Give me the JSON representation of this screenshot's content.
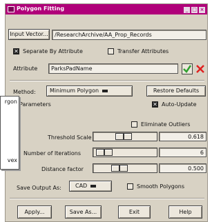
{
  "window": {
    "title": "Polygon Fitting",
    "title_buttons": [
      "_",
      "□",
      "×"
    ]
  },
  "input": {
    "button_label": "Input Vector...",
    "path": "/ResearchArchive/AA_Prop_Records"
  },
  "options": {
    "separate_by_attribute": {
      "label": "Separate By Attribute",
      "checked": true
    },
    "transfer_attributes": {
      "label": "Transfer Attributes",
      "checked": false
    }
  },
  "attribute": {
    "label": "Attribute",
    "value": "ParksPadName"
  },
  "method": {
    "label": "Method:",
    "value": "Minimum Polygon",
    "restore_label": "Restore Defaults"
  },
  "parameters": {
    "label": "Parameters",
    "auto_update": {
      "label": "Auto-Update",
      "checked": true
    },
    "eliminate_outliers": {
      "label": "Eliminate Outliers",
      "checked": false
    }
  },
  "sliders": [
    {
      "label": "Threshold Scale",
      "value": "0.618",
      "fraction": 0.47
    },
    {
      "label": "Number of Iterations",
      "value": "6",
      "fraction": 0.05
    },
    {
      "label": "Distance factor",
      "value": "0.500",
      "fraction": 0.38
    }
  ],
  "save_output": {
    "label": "Save Output As:",
    "value": "CAD",
    "smooth_label": "Smooth Polygons",
    "smooth_checked": false
  },
  "buttons": {
    "apply": "Apply...",
    "save_as": "Save As...",
    "exit": "Exit",
    "help": "Help"
  },
  "popup": {
    "items": [
      "rgon",
      "vex"
    ]
  },
  "colors": {
    "title_bar": "#b0007a",
    "panel": "#d8d2c4",
    "check_icon": "#2fa02f",
    "delete_icon": "#e02020"
  }
}
